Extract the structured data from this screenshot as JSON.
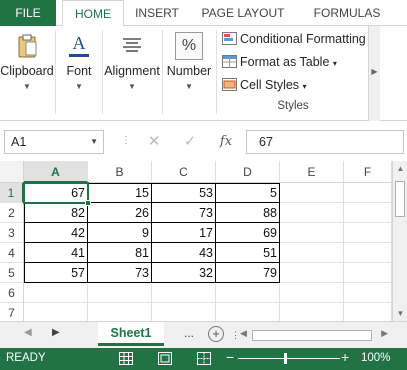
{
  "ribbon_tabs": {
    "file": "FILE",
    "home": "HOME",
    "insert": "INSERT",
    "page_layout": "PAGE LAYOUT",
    "formulas": "FORMULAS"
  },
  "ribbon": {
    "clipboard": "Clipboard",
    "font": "Font",
    "alignment": "Alignment",
    "number": "Number",
    "number_icon": "%",
    "font_icon": "A",
    "conditional_formatting": "Conditional Formatting",
    "format_as_table": "Format as Table",
    "cell_styles": "Cell Styles",
    "styles_group": "Styles"
  },
  "formula_bar": {
    "name_box": "A1",
    "fx": "fx",
    "value": "67"
  },
  "grid": {
    "columns": [
      "A",
      "B",
      "C",
      "D",
      "E",
      "F"
    ],
    "rows": [
      "1",
      "2",
      "3",
      "4",
      "5",
      "6",
      "7"
    ],
    "cells": [
      [
        "67",
        "15",
        "53",
        "5"
      ],
      [
        "82",
        "26",
        "73",
        "88"
      ],
      [
        "42",
        "9",
        "17",
        "69"
      ],
      [
        "41",
        "81",
        "43",
        "51"
      ],
      [
        "57",
        "73",
        "32",
        "79"
      ]
    ]
  },
  "sheets": {
    "active": "Sheet1",
    "more": "..."
  },
  "status": {
    "ready": "READY",
    "zoom": "100%"
  },
  "colors": {
    "accent": "#217346"
  },
  "icons": [
    "clipboard-icon",
    "font-icon",
    "alignment-icon",
    "number-icon",
    "conditional-formatting-icon",
    "format-as-table-icon",
    "cell-styles-icon",
    "cancel-icon",
    "enter-icon",
    "fx-icon",
    "add-sheet-icon",
    "normal-view-icon",
    "page-layout-view-icon",
    "page-break-view-icon"
  ]
}
